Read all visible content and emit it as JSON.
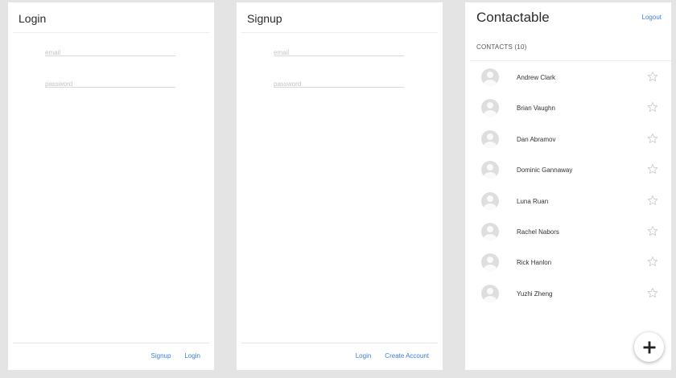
{
  "login": {
    "title": "Login",
    "email_placeholder": "email",
    "password_placeholder": "password",
    "signup_label": "Signup",
    "login_label": "Login"
  },
  "signup": {
    "title": "Signup",
    "email_placeholder": "email",
    "password_placeholder": "password",
    "login_label": "Login",
    "create_label": "Create Account"
  },
  "contacts": {
    "app_title": "Contactable",
    "logout_label": "Logout",
    "section_label": "CONTACTS (10)",
    "items": [
      {
        "name": "Andrew Clark"
      },
      {
        "name": "Brian Vaughn"
      },
      {
        "name": "Dan Abramov"
      },
      {
        "name": "Dominic Gannaway"
      },
      {
        "name": "Luna Ruan"
      },
      {
        "name": "Rachel Nabors"
      },
      {
        "name": "Rick Hanlon"
      },
      {
        "name": "Yuzhi Zheng"
      }
    ],
    "icons": {
      "avatar": "person-avatar-icon",
      "favorite": "star-outline-icon",
      "add": "plus-icon"
    }
  },
  "colors": {
    "link": "#3b7fd6",
    "background": "#e4e4e4",
    "panel": "#ffffff"
  }
}
